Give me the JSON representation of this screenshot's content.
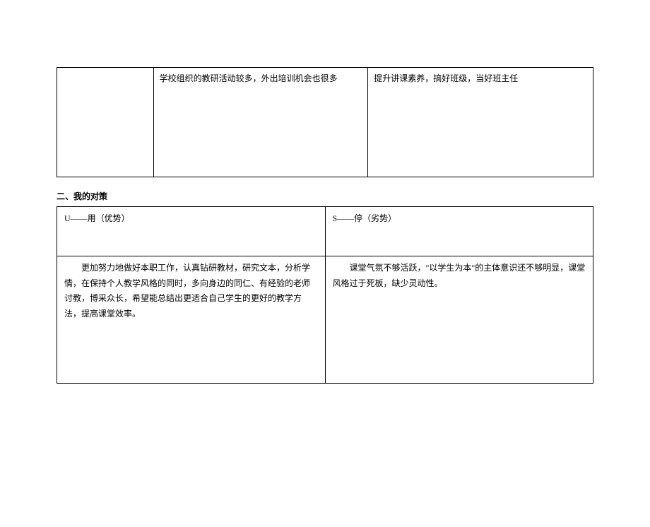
{
  "table1": {
    "row": {
      "col_b": "学校组织的教研活动较多，外出培训机会也很多",
      "col_c": "提升讲课素养，搞好班级，当好班主任"
    }
  },
  "section2": {
    "heading": "二、我的对策"
  },
  "table2": {
    "headers": {
      "left": "U——用（优势）",
      "right": "S——停（劣势）"
    },
    "content": {
      "left": "更加努力地做好本职工作，认真钻研教材，研究文本，分析学情，在保持个人教学风格的同时，多向身边的同仁、有经验的老师讨教，博采众长，希望能总结出更适合自己学生的更好的教学方法，提高课堂效率。",
      "right": "课堂气氛不够活跃，\"以学生为本\"的主体意识还不够明显，课堂风格过于死板，缺少灵动性。"
    }
  }
}
